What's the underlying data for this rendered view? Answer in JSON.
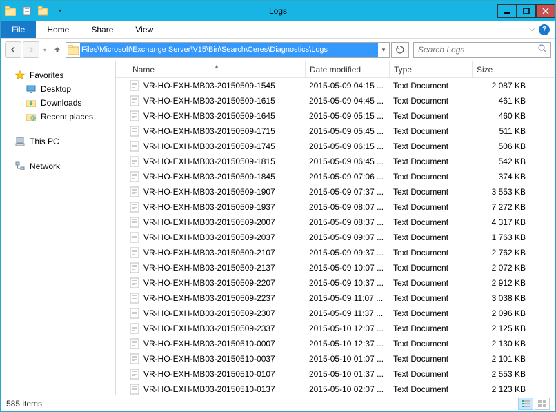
{
  "window": {
    "title": "Logs"
  },
  "menubar": {
    "file": "File",
    "tabs": [
      "Home",
      "Share",
      "View"
    ]
  },
  "address": {
    "path": "Files\\Microsoft\\Exchange Server\\V15\\Bin\\Search\\Ceres\\Diagnostics\\Logs"
  },
  "search": {
    "placeholder": "Search Logs"
  },
  "navpane": {
    "favorites": "Favorites",
    "favorites_items": [
      "Desktop",
      "Downloads",
      "Recent places"
    ],
    "thispc": "This PC",
    "network": "Network"
  },
  "columns": {
    "name": "Name",
    "date": "Date modified",
    "type": "Type",
    "size": "Size"
  },
  "files": [
    {
      "name": "VR-HO-EXH-MB03-20150509-1545",
      "date": "2015-05-09 04:15 ...",
      "type": "Text Document",
      "size": "2 087 KB"
    },
    {
      "name": "VR-HO-EXH-MB03-20150509-1615",
      "date": "2015-05-09 04:45 ...",
      "type": "Text Document",
      "size": "461 KB"
    },
    {
      "name": "VR-HO-EXH-MB03-20150509-1645",
      "date": "2015-05-09 05:15 ...",
      "type": "Text Document",
      "size": "460 KB"
    },
    {
      "name": "VR-HO-EXH-MB03-20150509-1715",
      "date": "2015-05-09 05:45 ...",
      "type": "Text Document",
      "size": "511 KB"
    },
    {
      "name": "VR-HO-EXH-MB03-20150509-1745",
      "date": "2015-05-09 06:15 ...",
      "type": "Text Document",
      "size": "506 KB"
    },
    {
      "name": "VR-HO-EXH-MB03-20150509-1815",
      "date": "2015-05-09 06:45 ...",
      "type": "Text Document",
      "size": "542 KB"
    },
    {
      "name": "VR-HO-EXH-MB03-20150509-1845",
      "date": "2015-05-09 07:06 ...",
      "type": "Text Document",
      "size": "374 KB"
    },
    {
      "name": "VR-HO-EXH-MB03-20150509-1907",
      "date": "2015-05-09 07:37 ...",
      "type": "Text Document",
      "size": "3 553 KB"
    },
    {
      "name": "VR-HO-EXH-MB03-20150509-1937",
      "date": "2015-05-09 08:07 ...",
      "type": "Text Document",
      "size": "7 272 KB"
    },
    {
      "name": "VR-HO-EXH-MB03-20150509-2007",
      "date": "2015-05-09 08:37 ...",
      "type": "Text Document",
      "size": "4 317 KB"
    },
    {
      "name": "VR-HO-EXH-MB03-20150509-2037",
      "date": "2015-05-09 09:07 ...",
      "type": "Text Document",
      "size": "1 763 KB"
    },
    {
      "name": "VR-HO-EXH-MB03-20150509-2107",
      "date": "2015-05-09 09:37 ...",
      "type": "Text Document",
      "size": "2 762 KB"
    },
    {
      "name": "VR-HO-EXH-MB03-20150509-2137",
      "date": "2015-05-09 10:07 ...",
      "type": "Text Document",
      "size": "2 072 KB"
    },
    {
      "name": "VR-HO-EXH-MB03-20150509-2207",
      "date": "2015-05-09 10:37 ...",
      "type": "Text Document",
      "size": "2 912 KB"
    },
    {
      "name": "VR-HO-EXH-MB03-20150509-2237",
      "date": "2015-05-09 11:07 ...",
      "type": "Text Document",
      "size": "3 038 KB"
    },
    {
      "name": "VR-HO-EXH-MB03-20150509-2307",
      "date": "2015-05-09 11:37 ...",
      "type": "Text Document",
      "size": "2 096 KB"
    },
    {
      "name": "VR-HO-EXH-MB03-20150509-2337",
      "date": "2015-05-10 12:07 ...",
      "type": "Text Document",
      "size": "2 125 KB"
    },
    {
      "name": "VR-HO-EXH-MB03-20150510-0007",
      "date": "2015-05-10 12:37 ...",
      "type": "Text Document",
      "size": "2 130 KB"
    },
    {
      "name": "VR-HO-EXH-MB03-20150510-0037",
      "date": "2015-05-10 01:07 ...",
      "type": "Text Document",
      "size": "2 101 KB"
    },
    {
      "name": "VR-HO-EXH-MB03-20150510-0107",
      "date": "2015-05-10 01:37 ...",
      "type": "Text Document",
      "size": "2 553 KB"
    },
    {
      "name": "VR-HO-EXH-MB03-20150510-0137",
      "date": "2015-05-10 02:07 ...",
      "type": "Text Document",
      "size": "2 123 KB"
    }
  ],
  "status": {
    "count": "585 items"
  }
}
